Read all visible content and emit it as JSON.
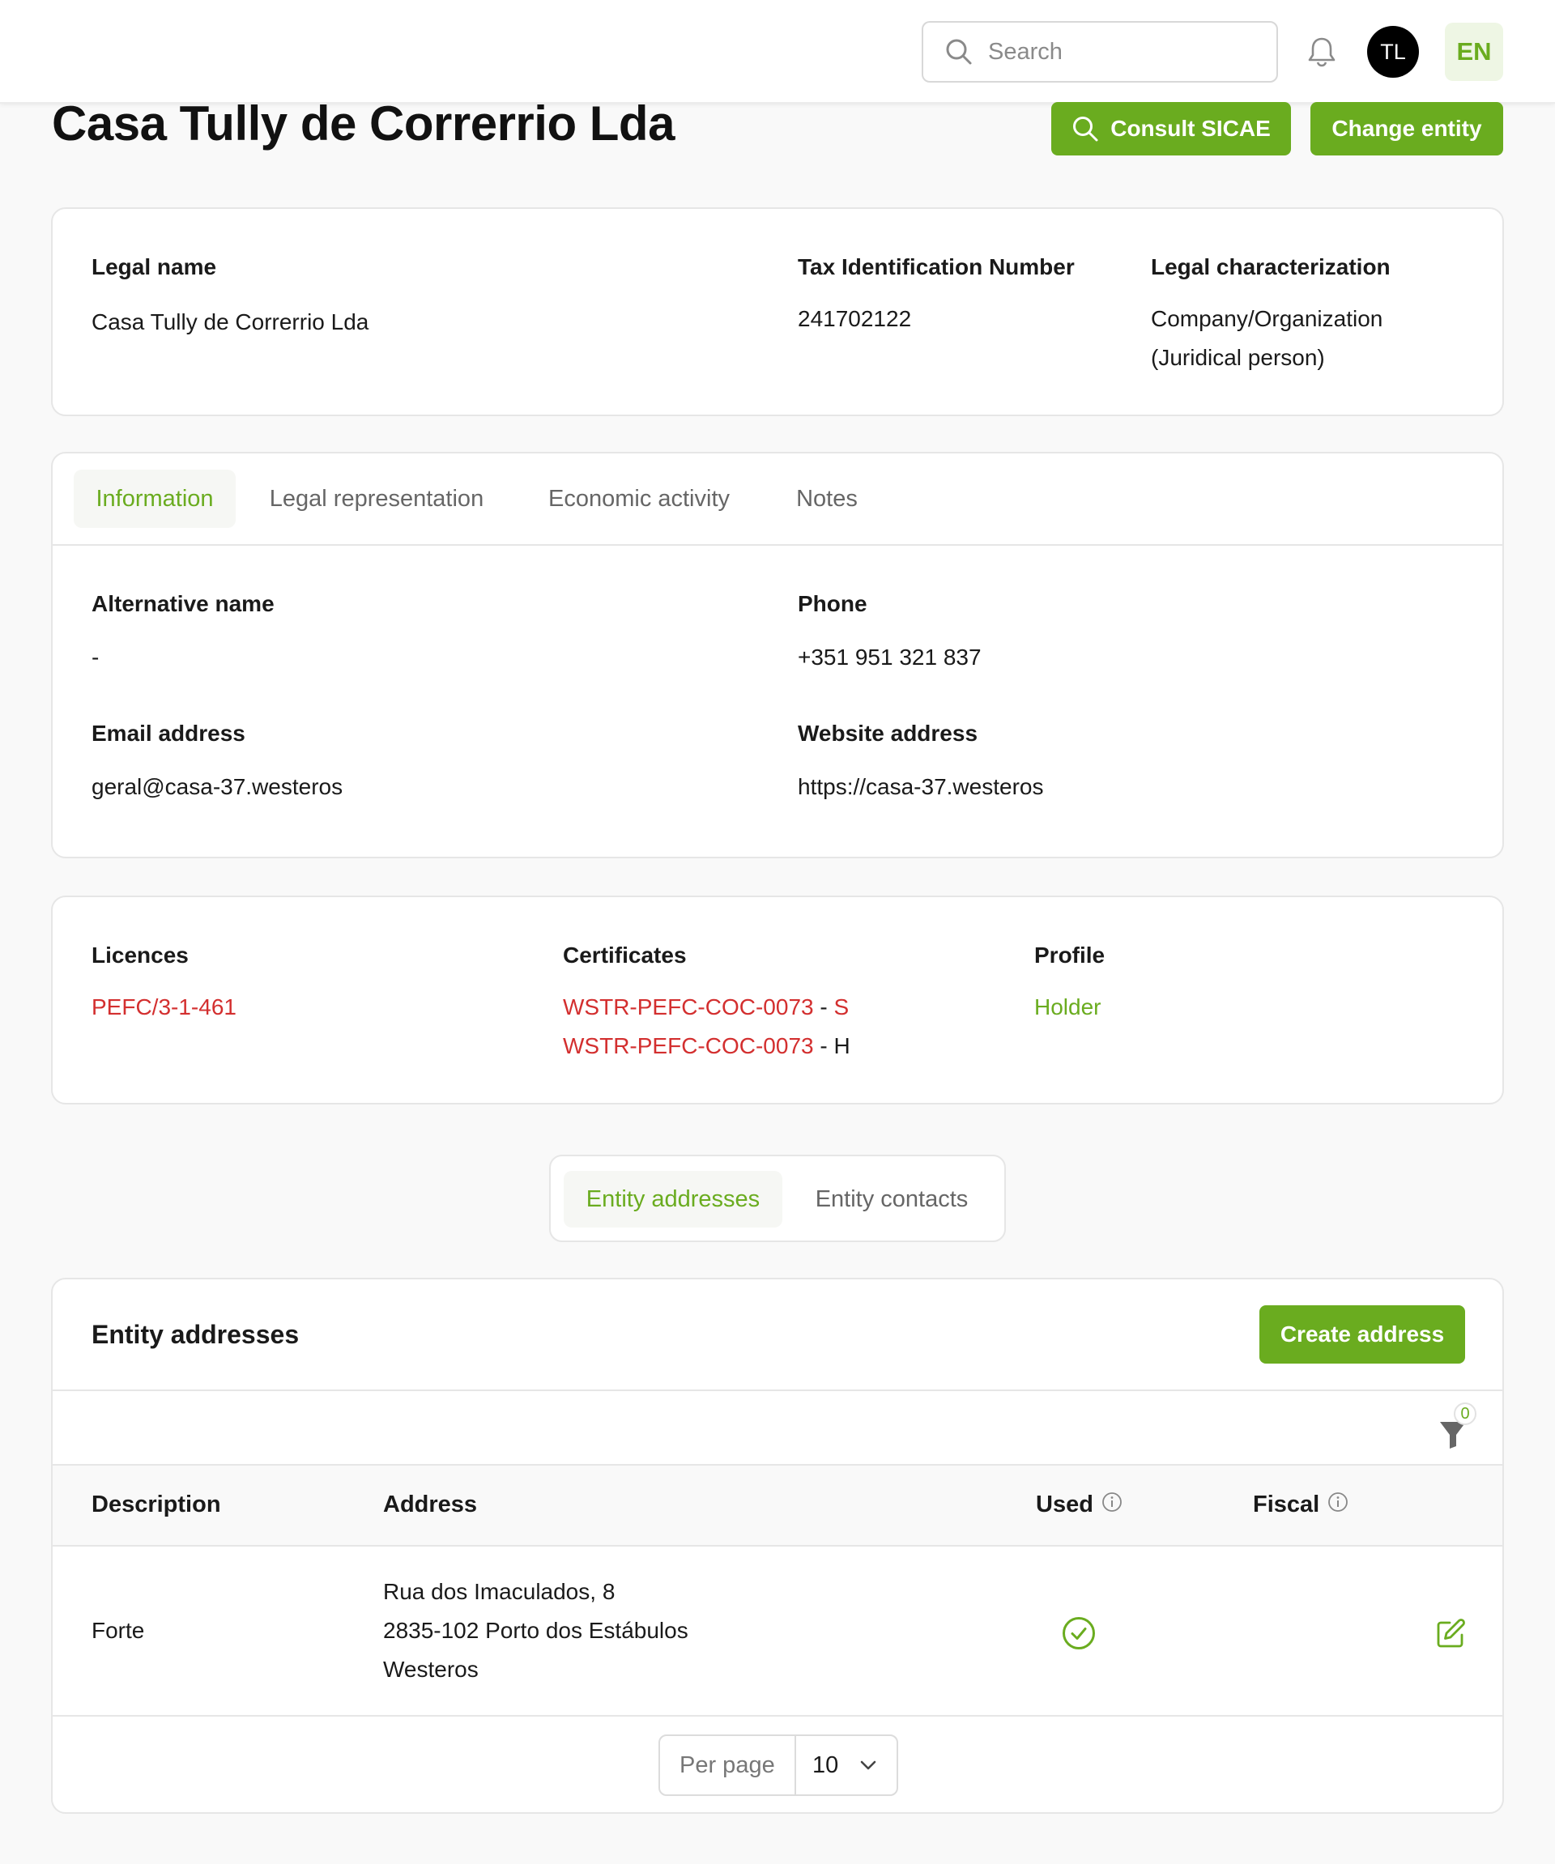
{
  "header": {
    "search_placeholder": "Search",
    "avatar_initials": "TL",
    "language": "EN"
  },
  "page": {
    "title": "Casa Tully de Correrrio Lda",
    "consult_button": "Consult SICAE",
    "change_entity_button": "Change entity"
  },
  "summary": {
    "legal_name_label": "Legal name",
    "legal_name_value": "Casa Tully de Correrrio Lda",
    "tin_label": "Tax Identification Number",
    "tin_value": "241702122",
    "legal_char_label": "Legal characterization",
    "legal_char_value_line1": "Company/Organization",
    "legal_char_value_line2": "(Juridical person)"
  },
  "info_tabs": {
    "tabs": [
      "Information",
      "Legal representation",
      "Economic activity",
      "Notes"
    ],
    "active": "Information"
  },
  "information": {
    "alt_name_label": "Alternative name",
    "alt_name_value": "-",
    "phone_label": "Phone",
    "phone_value": "+351 951 321 837",
    "email_label": "Email address",
    "email_value": "geral@casa-37.westeros",
    "website_label": "Website address",
    "website_value": "https://casa-37.westeros"
  },
  "credentials": {
    "licences_label": "Licences",
    "licence_1": "PEFC/3-1-461",
    "certificates_label": "Certificates",
    "certificate_1_code": "WSTR-PEFC-COC-0073",
    "certificate_1_sep": " - ",
    "certificate_1_suffix": "S",
    "certificate_2_code": "WSTR-PEFC-COC-0073",
    "certificate_2_sep": " - ",
    "certificate_2_suffix": "H",
    "profile_label": "Profile",
    "profile_value": "Holder"
  },
  "sub_tabs": {
    "addresses": "Entity addresses",
    "contacts": "Entity contacts",
    "active": "Entity addresses"
  },
  "addresses": {
    "title": "Entity addresses",
    "create_button": "Create address",
    "filter_count": "0",
    "columns": [
      "Description",
      "Address",
      "Used",
      "Fiscal"
    ],
    "rows": [
      {
        "description": "Forte",
        "address_line1": "Rua dos Imaculados, 8",
        "address_line2": "2835-102 Porto dos Estábulos",
        "address_line3": "Westeros",
        "used": true,
        "fiscal": false
      }
    ],
    "per_page_label": "Per page",
    "per_page_value": "10"
  },
  "colors": {
    "accent": "#6aac1f",
    "link_red": "#d32f2f",
    "background": "#f9f9f9"
  },
  "icons": [
    "search-icon",
    "bell-icon",
    "filter-icon",
    "info-icon",
    "check-circle-icon",
    "edit-icon",
    "chevron-down-icon"
  ]
}
